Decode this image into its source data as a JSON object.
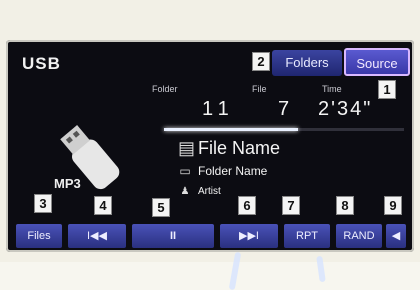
{
  "header": {
    "source_name": "USB"
  },
  "buttons": {
    "folders": "Folders",
    "source": "Source"
  },
  "info": {
    "folder_label": "Folder",
    "folder_value": "11",
    "file_label": "File",
    "file_value": "7",
    "time_label": "Time",
    "time_value": "2'34\""
  },
  "playback_progress": 0.56,
  "media": {
    "format": "MP3"
  },
  "track": {
    "file_name": "File Name",
    "folder_name": "Folder Name",
    "artist": "Artist"
  },
  "controls": {
    "files": "Files",
    "prev": "I◀◀",
    "play_pause": "II",
    "next": "▶▶I",
    "repeat": "RPT",
    "random": "RAND",
    "volume": "◀"
  },
  "callouts": [
    "1",
    "2",
    "3",
    "4",
    "5",
    "6",
    "7",
    "8",
    "9"
  ],
  "icons": {
    "usb": "usb-drive-icon",
    "file": "file-icon",
    "folder": "folder-icon",
    "artist": "artist-icon"
  },
  "colors": {
    "screen_bg": "#0c0c12",
    "button_blue": "#3b44a0",
    "source_border": "#d9b8ff"
  }
}
